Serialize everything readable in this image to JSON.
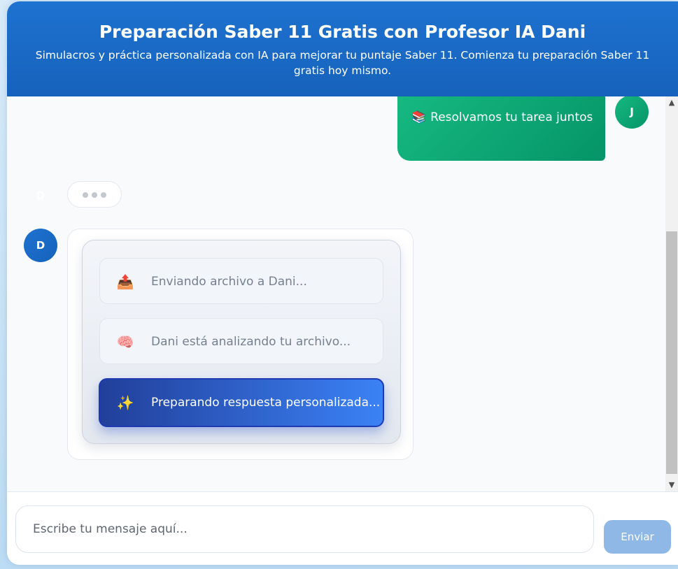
{
  "header": {
    "title": "Preparación Saber 11 Gratis con Profesor IA Dani",
    "subtitle": "Simulacros y práctica personalizada con IA para mejorar tu puntaje Saber 11. Comienza tu preparación Saber 11 gratis hoy mismo."
  },
  "chat": {
    "user_message": {
      "emoji": "📚",
      "text": "Resolvamos tu tarea juntos",
      "avatar_initial": "J"
    },
    "typing_avatar_initial": "D",
    "bot_avatar_initial": "D",
    "progress_steps": [
      {
        "icon": "📤",
        "label": "Enviando archivo a Dani...",
        "state": "done"
      },
      {
        "icon": "🧠",
        "label": "Dani está analizando tu archivo...",
        "state": "done"
      },
      {
        "icon": "✨",
        "label": "Preparando respuesta personalizada...",
        "state": "active"
      }
    ]
  },
  "input": {
    "placeholder": "Escribe tu mensaje aquí...",
    "send_label": "Enviar"
  },
  "colors": {
    "header": "#1e72d0",
    "user_green": "#10b981",
    "active_step": "#2d5bd0",
    "send_disabled": "#8fb8e6"
  }
}
